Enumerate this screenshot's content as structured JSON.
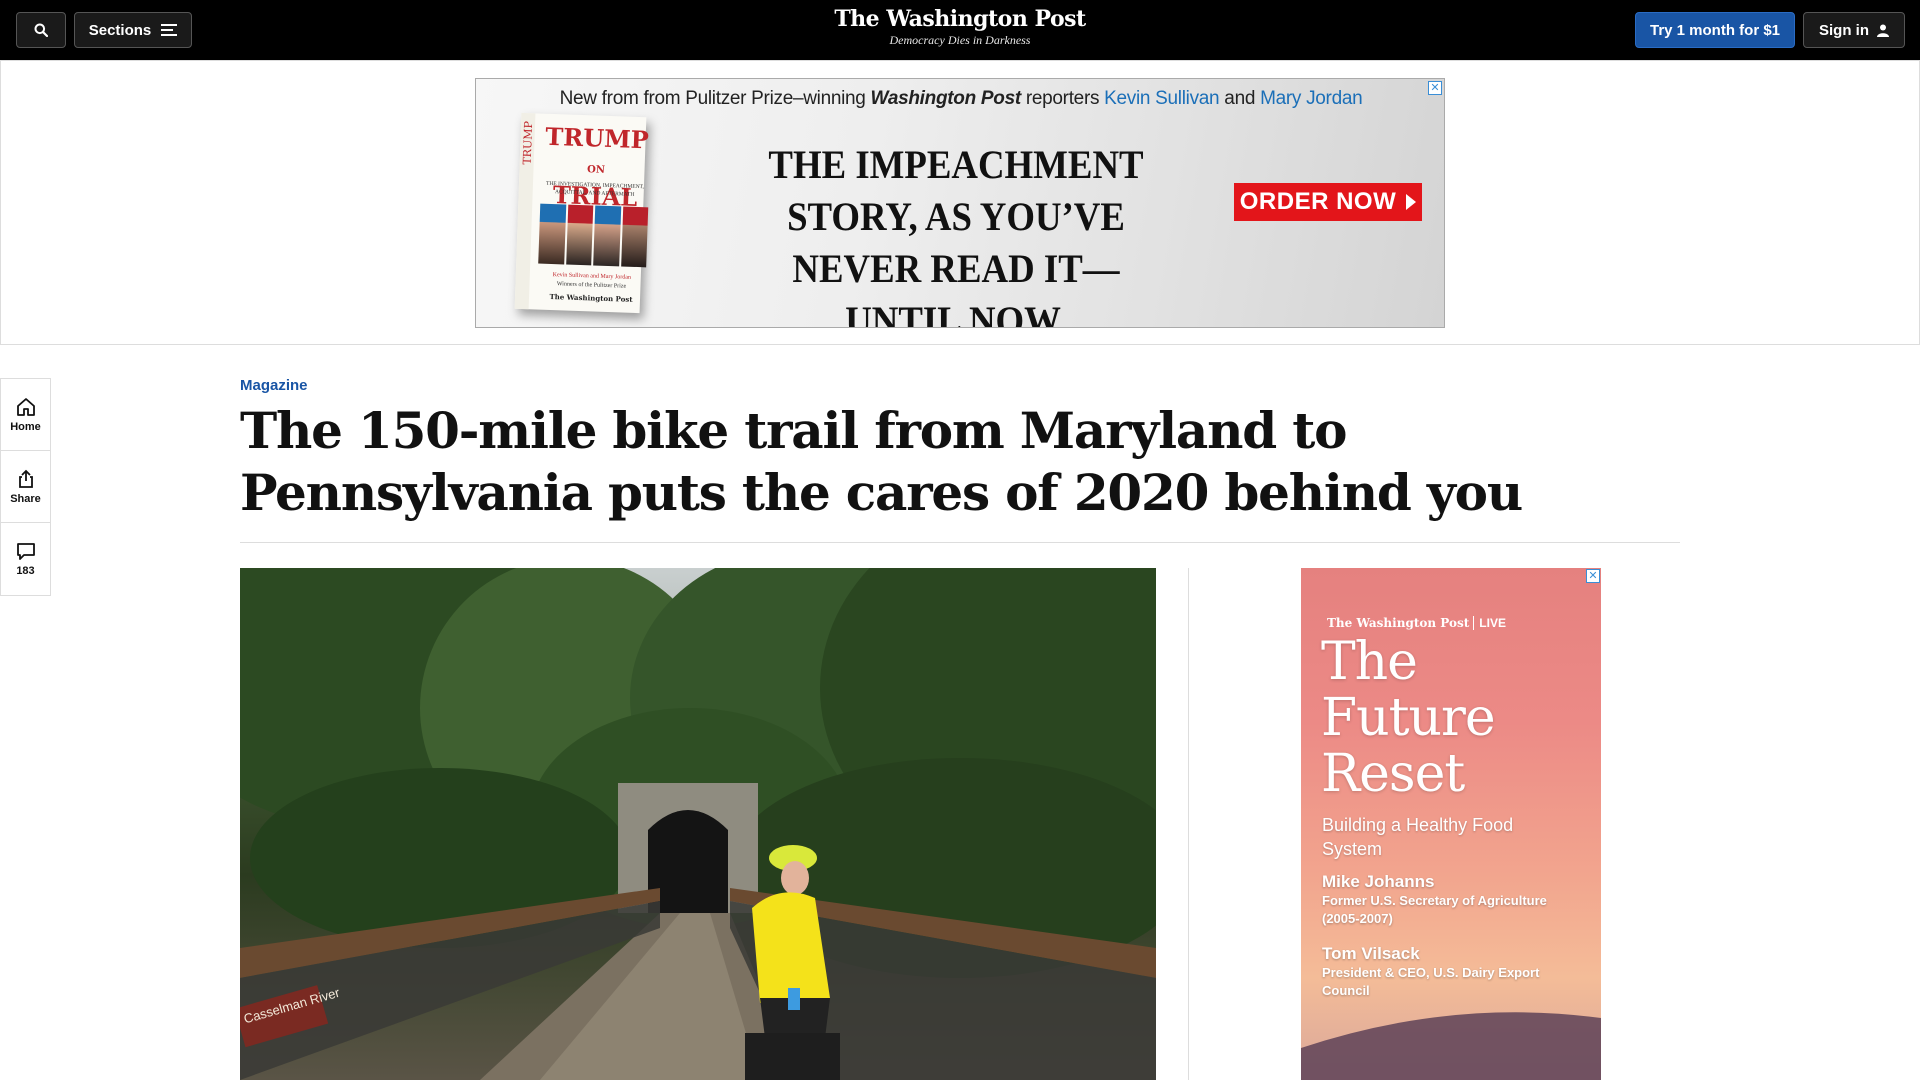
{
  "topnav": {
    "sections_label": "Sections",
    "logo": "The Washington Post",
    "tagline": "Democracy Dies in Darkness",
    "trial_label": "Try 1 month for $1",
    "signin_label": "Sign in",
    "accent_color": "#1955a5"
  },
  "top_ad": {
    "line_prefix": "New from from Pulitzer Prize–winning",
    "line_pub": "Washington Post",
    "line_mid": "reporters",
    "author_1": "Kevin Sullivan",
    "line_and": "and",
    "author_2": "Mary Jordan",
    "book_spine": "TRUMP",
    "book_title": "TRUMP",
    "book_title_on": "ON",
    "book_title_2": "TRIAL",
    "book_subtitle": "The Investigation, Impeachment, Acquittal, and Aftermath",
    "book_authors": "Kevin Sullivan and Mary Jordan",
    "book_authors_note": "Winners of the Pulitzer Prize",
    "book_publisher": "The Washington Post",
    "headline": "The Impeachment story, as you’ve never read it—until now.",
    "cta": "ORDER NOW",
    "close_icon": "close-icon"
  },
  "rail": {
    "items": [
      {
        "label": "Home",
        "icon": "home-icon"
      },
      {
        "label": "Share",
        "icon": "share-icon"
      },
      {
        "label": "183",
        "icon": "comment-icon"
      }
    ]
  },
  "article": {
    "kicker": "Magazine",
    "headline": "The 150-mile bike trail from Maryland to Pennsylvania puts the cares of 2020 behind you",
    "photo_sign": "Casselman River"
  },
  "side_ad": {
    "brand": "The Washington Post",
    "brand_tag": "LIVE",
    "title": "The Future Reset",
    "subtitle": "Building a Healthy Food System",
    "speakers": [
      {
        "name": "Mike Johanns",
        "role": "Former U.S. Secretary of Agriculture (2005-2007)"
      },
      {
        "name": "Tom Vilsack",
        "role": "President & CEO, U.S. Dairy Export Council"
      }
    ]
  }
}
